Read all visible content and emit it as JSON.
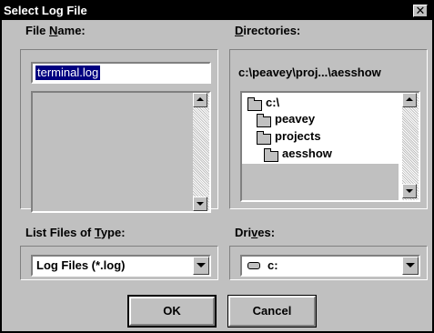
{
  "window": {
    "title": "Select Log File",
    "close_glyph": "✕"
  },
  "file_name": {
    "label_pre": "File ",
    "label_key": "N",
    "label_post": "ame:",
    "value": "terminal.log",
    "list_items": []
  },
  "directories": {
    "label_pre": "",
    "label_key": "D",
    "label_post": "irectories:",
    "current_path": "c:\\peavey\\proj...\\aesshow",
    "tree": [
      {
        "label": "c:\\",
        "selected": false
      },
      {
        "label": "peavey",
        "selected": false
      },
      {
        "label": "projects",
        "selected": false
      },
      {
        "label": "aesshow",
        "selected": true
      }
    ]
  },
  "file_type": {
    "label_pre": "List Files of ",
    "label_key": "T",
    "label_post": "ype:",
    "selected": "Log Files (*.log)"
  },
  "drives": {
    "label_pre": "Dri",
    "label_key": "v",
    "label_post": "es:",
    "selected": "c:",
    "icon": "drive-icon"
  },
  "buttons": {
    "ok": "OK",
    "cancel": "Cancel"
  },
  "colors": {
    "face": "#c0c0c0",
    "title_bar": "#000000",
    "field": "#ffffff",
    "shadow": "#808080"
  }
}
